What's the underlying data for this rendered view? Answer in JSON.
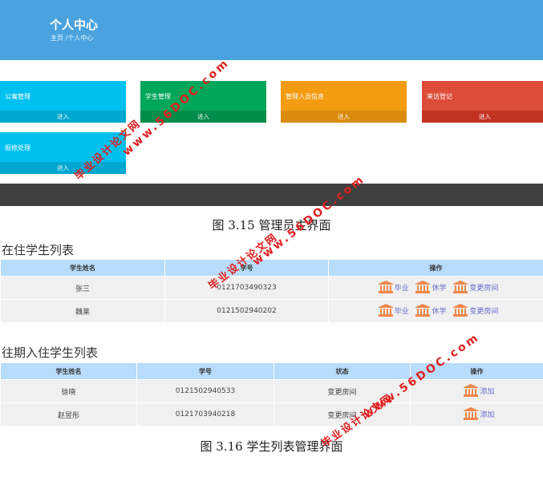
{
  "dashboard": {
    "title": "个人中心",
    "breadcrumb": "主页 /个人中心",
    "tiles": [
      {
        "label": "公寓管理",
        "action": "进入",
        "color": "#00c0ef"
      },
      {
        "label": "学生管理",
        "action": "进入",
        "color": "#00a65a"
      },
      {
        "label": "管理人员信息",
        "action": "进入",
        "color": "#f39c12"
      },
      {
        "label": "来访登记",
        "action": "进入",
        "color": "#dd4b39"
      },
      {
        "label": "报修处理",
        "action": "进入",
        "color": "#00c0ef"
      }
    ]
  },
  "caption1": "图 3.15 管理员主界面",
  "current_students": {
    "title": "在住学生列表",
    "headers": [
      "学生姓名",
      "学号",
      "操作"
    ],
    "rows": [
      {
        "name": "张三",
        "id": "0121703490323"
      },
      {
        "name": "魏莱",
        "id": "0121502940202"
      }
    ],
    "actions": [
      "毕业",
      "休学",
      "变更房间"
    ]
  },
  "past_students": {
    "title": "往期入住学生列表",
    "headers": [
      "学生姓名",
      "学号",
      "状态",
      "操作"
    ],
    "rows": [
      {
        "name": "徐晓",
        "id": "0121502940533",
        "status": "变更房间",
        "action": "添加"
      },
      {
        "name": "赵昱彤",
        "id": "0121703940218",
        "status": "变更房间",
        "action": "添加"
      }
    ]
  },
  "caption2": "图 3.16 学生列表管理界面",
  "watermark": {
    "cn": "毕业设计论文网",
    "url": "www.56DOC.com"
  },
  "icon_color": "#f0874a"
}
